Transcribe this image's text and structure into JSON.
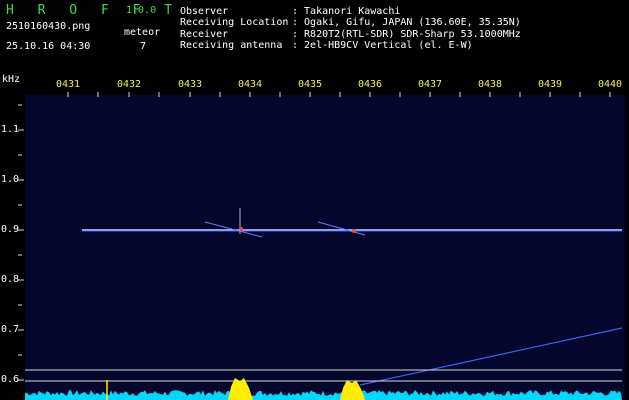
{
  "app": {
    "title": "H R O F F T",
    "version": "1.0.0"
  },
  "file": {
    "name": "2510160430.png",
    "datetime": "25.10.16 04:30"
  },
  "meteor": {
    "label": "meteor",
    "count": "7"
  },
  "info": [
    {
      "key": "Observer",
      "value": ": Takanori Kawachi"
    },
    {
      "key": "Receiving Location",
      "value": ": Ogaki, Gifu, JAPAN (136.60E, 35.35N)"
    },
    {
      "key": "Receiver",
      "value": ": R820T2(RTL-SDR) SDR-Sharp 53.1000MHz"
    },
    {
      "key": "Receiving antenna",
      "value": ": 2el-HB9CV Vertical (el. E-W)"
    }
  ],
  "axis": {
    "y_unit": "kHz",
    "x_ticks": [
      "0431",
      "0432",
      "0433",
      "0434",
      "0435",
      "0436",
      "0437",
      "0438",
      "0439",
      "0440"
    ],
    "y_ticks": [
      "1.1",
      "1.0",
      "0.9",
      "0.8",
      "0.7",
      "0.6"
    ]
  },
  "colors": {
    "text_header": "#ffffff",
    "app_title": "#3fdc3f",
    "tick": "#f0f060",
    "trace": "#ffffff",
    "level": "#00e5ff",
    "peak": "#ffee00"
  }
}
